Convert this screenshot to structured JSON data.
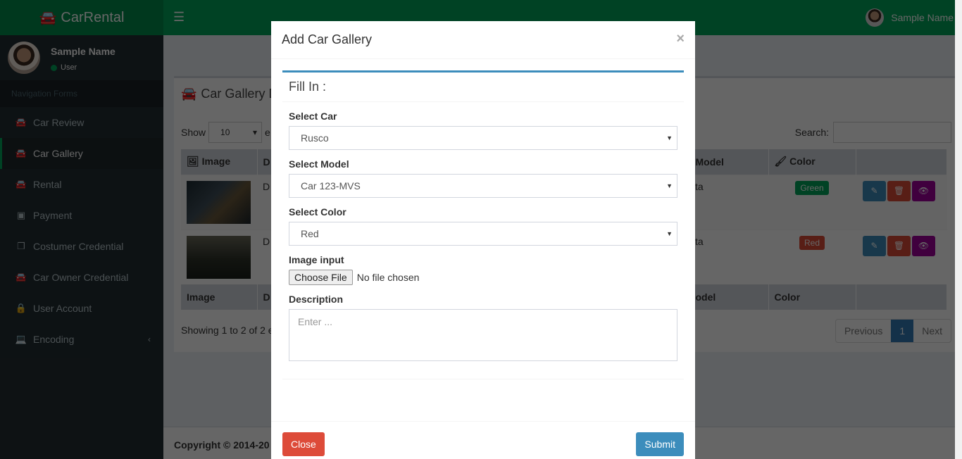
{
  "header": {
    "logo_text": "CarRental",
    "logo_icon": "car-icon",
    "menu_icon": "hamburger-icon",
    "user_name": "Sample Name"
  },
  "sidebar": {
    "user": {
      "name": "Sample Name",
      "status": "User"
    },
    "nav_header": "Navigation Forms",
    "items": [
      {
        "label": "Car Review",
        "icon": "car-icon",
        "active": false
      },
      {
        "label": "Car Gallery",
        "icon": "car-icon",
        "active": true
      },
      {
        "label": "Rental",
        "icon": "car-icon",
        "active": false
      },
      {
        "label": "Payment",
        "icon": "money-icon",
        "active": false
      },
      {
        "label": "Costumer Credential",
        "icon": "copy-icon",
        "active": false
      },
      {
        "label": "Car Owner Credential",
        "icon": "car-icon",
        "active": false
      },
      {
        "label": "User Account",
        "icon": "lock-icon",
        "active": false
      },
      {
        "label": "Encoding",
        "icon": "laptop-icon",
        "active": false,
        "has_submenu": true
      }
    ]
  },
  "main": {
    "box_title": "Car Gallery D",
    "show_label": "Show",
    "length_value": "10",
    "entries_label": "e",
    "search_label": "Search:",
    "table": {
      "headers": [
        "Image",
        "D",
        "Model",
        "Color",
        ""
      ],
      "footer_headers": [
        "Image",
        "D",
        "odel",
        "Color",
        ""
      ],
      "rows": [
        {
          "desc": "D",
          "model": "ta",
          "color": "Green",
          "color_hex": "#00a65a"
        },
        {
          "desc": "D",
          "model": "ta",
          "color": "Red",
          "color_hex": "#dd4b39"
        }
      ]
    },
    "showing_text": "Showing 1 to 2 of 2 e",
    "pagination": {
      "previous": "Previous",
      "current": "1",
      "next": "Next"
    }
  },
  "footer": {
    "copyright": "Copyright © 2014-20"
  },
  "modal": {
    "title": "Add Car Gallery",
    "close_symbol": "×",
    "section_title": "Fill In :",
    "fields": {
      "car": {
        "label": "Select Car",
        "value": "Rusco"
      },
      "model": {
        "label": "Select Model",
        "value": "Car 123-MVS"
      },
      "color": {
        "label": "Select Color",
        "value": "Red"
      },
      "image": {
        "label": "Image input",
        "button": "Choose File",
        "status": "No file chosen"
      },
      "description": {
        "label": "Description",
        "placeholder": "Enter ..."
      }
    },
    "close_button": "Close",
    "submit_button": "Submit"
  },
  "colors": {
    "brand": "#00a65a",
    "primary": "#3c8dbc",
    "danger": "#dd4b39",
    "edit": "#3c8dbc",
    "view": "#a0009c"
  }
}
